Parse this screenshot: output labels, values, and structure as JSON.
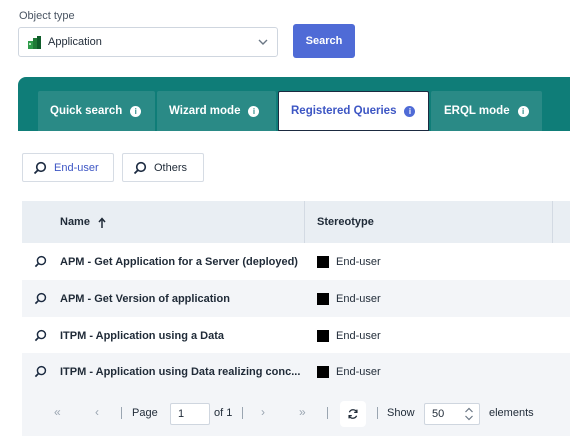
{
  "object_type": {
    "label": "Object type",
    "selected": "Application",
    "icon": "application-icon"
  },
  "search_button": "Search",
  "tabs": [
    {
      "label": "Quick search",
      "active": false
    },
    {
      "label": "Wizard mode",
      "active": false
    },
    {
      "label": "Registered Queries",
      "active": true
    },
    {
      "label": "ERQL mode",
      "active": false
    }
  ],
  "filters": [
    {
      "label": "End-user",
      "active": true
    },
    {
      "label": "Others",
      "active": false
    }
  ],
  "table": {
    "columns": [
      "Name",
      "Stereotype"
    ],
    "sort_icon": "arrow-up-icon",
    "rows": [
      {
        "name": "APM - Get Application for a Server (deployed)",
        "stereotype": "End-user"
      },
      {
        "name": "APM - Get Version of application",
        "stereotype": "End-user"
      },
      {
        "name": "ITPM - Application using a Data",
        "stereotype": "End-user"
      },
      {
        "name": "ITPM - Application using Data realizing conc...",
        "stereotype": "End-user"
      }
    ]
  },
  "pagination": {
    "page_label": "Page",
    "page": "1",
    "of_label": "of 1",
    "show_label": "Show",
    "page_size": "50",
    "elements_label": "elements"
  },
  "colors": {
    "accent": "#4f6bd6",
    "tab_band": "#0f7d78",
    "header_bg": "#e9eef3"
  }
}
